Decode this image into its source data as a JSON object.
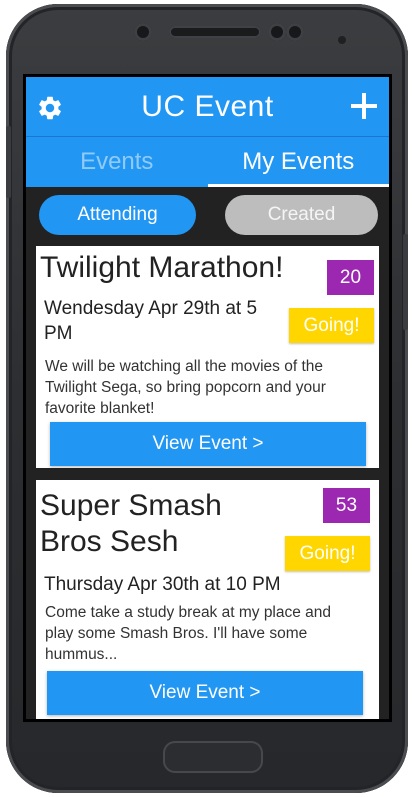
{
  "app": {
    "title": "UC Event",
    "left_icon": "gear-icon",
    "right_icon": "plus-icon",
    "colors": {
      "primary": "#2196f3",
      "count": "#9c27b0",
      "going": "#ffd600",
      "inactive_pill": "#bdbdbd"
    }
  },
  "tabs": [
    {
      "label": "Events",
      "active": false
    },
    {
      "label": "My Events",
      "active": true
    }
  ],
  "filters": [
    {
      "label": "Attending",
      "selected": true
    },
    {
      "label": "Created",
      "selected": false
    }
  ],
  "events": [
    {
      "title": "Twilight Marathon!",
      "count": "20",
      "status": "Going!",
      "when": "Wendesday Apr 29th at 5 PM",
      "description": "We will be watching all the movies of the Twilight Sega, so bring popcorn and your favorite blanket!",
      "button_label": "View Event >"
    },
    {
      "title": "Super Smash Bros Sesh",
      "count": "53",
      "status": "Going!",
      "when": "Thursday Apr 30th at 10 PM",
      "description": "Come take a study break at my place and play some Smash Bros. I'll have some hummus...",
      "button_label": "View Event >"
    }
  ]
}
